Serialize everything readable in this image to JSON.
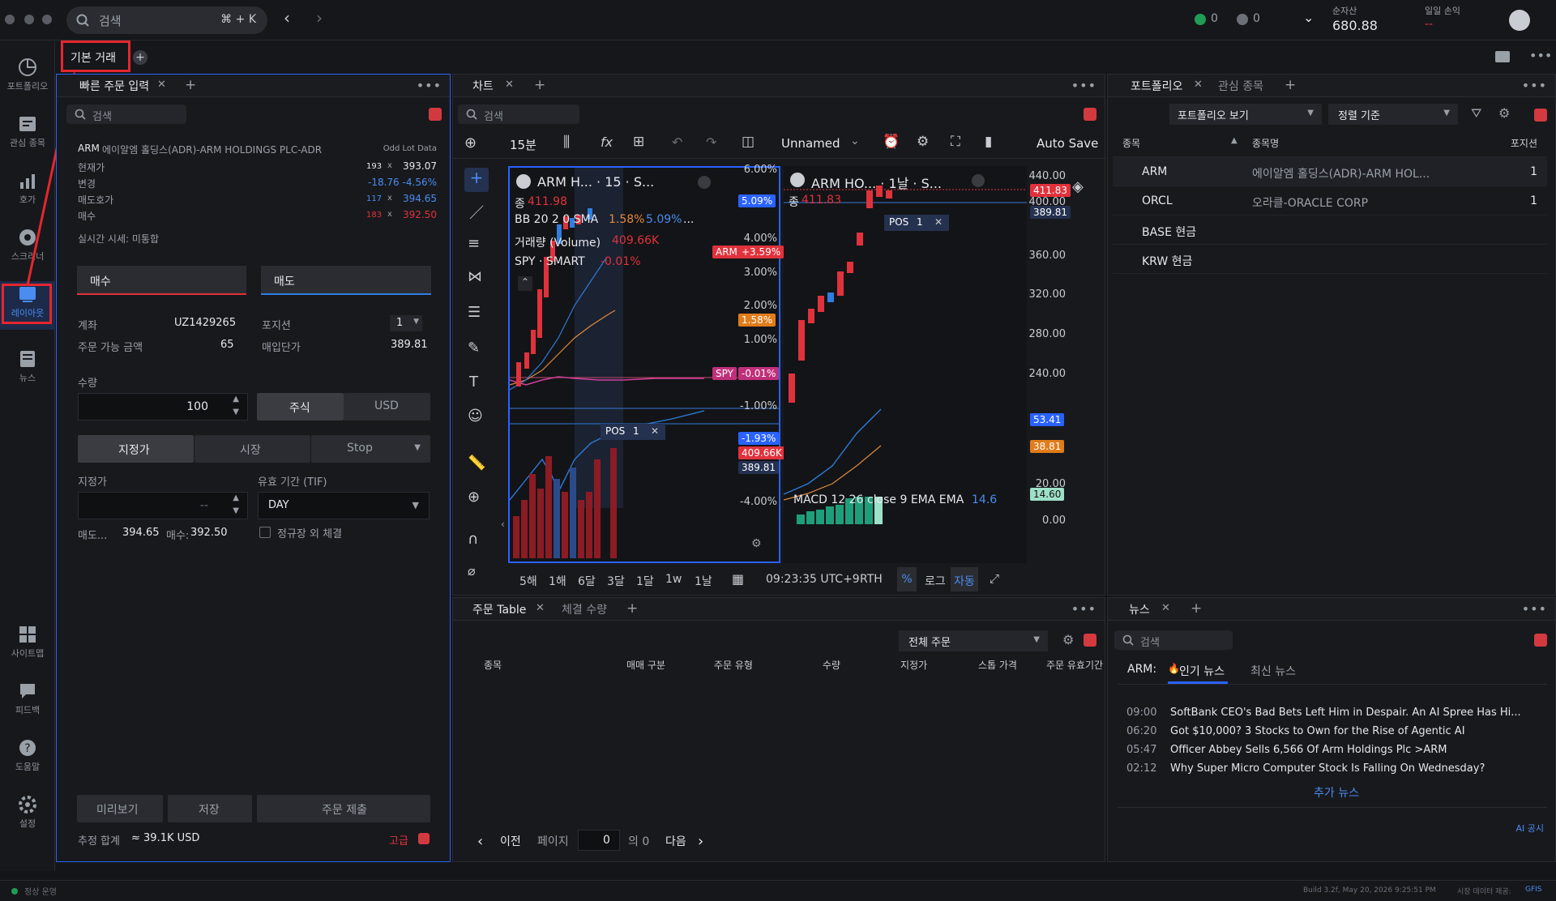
{
  "topbar": {
    "search_placeholder": "검색",
    "search_shortcut": "⌘ + K",
    "status_green_count": "0",
    "status_gray_count": "0",
    "net_assets_label": "순자산",
    "net_assets_value": "680.88",
    "daily_pl_label": "일일 손익",
    "daily_pl_value": "--"
  },
  "sidebar": {
    "items": [
      {
        "label": "포트폴리오",
        "icon": "portfolio-icon"
      },
      {
        "label": "관심 종목",
        "icon": "watchlist-icon"
      },
      {
        "label": "호가",
        "icon": "quote-icon"
      },
      {
        "label": "스크리너",
        "icon": "screener-icon"
      },
      {
        "label": "레이아웃",
        "icon": "layout-icon"
      },
      {
        "label": "뉴스",
        "icon": "news-icon"
      },
      {
        "label": "사이트맵",
        "icon": "sitemap-icon"
      },
      {
        "label": "피드백",
        "icon": "feedback-icon"
      },
      {
        "label": "도움말",
        "icon": "help-icon"
      },
      {
        "label": "설정",
        "icon": "settings-icon"
      }
    ]
  },
  "workspace_tab": "기본 거래",
  "order_panel": {
    "tab": "빠른 주문 입력",
    "search_placeholder": "검색",
    "symbol": "ARM",
    "symbol_name": "에이알엠 홀딩스(ADR)-ARM HOLDINGS PLC-ADR",
    "odd_lot": "Odd Lot Data",
    "rows": [
      {
        "label": "현재가",
        "qty": "193",
        "x": "x",
        "price": "393.07"
      },
      {
        "label": "변경",
        "qty": "-18.76",
        "x": "",
        "price": "-4.56%"
      },
      {
        "label": "매도호가",
        "qty": "117",
        "x": "x",
        "price": "394.65"
      },
      {
        "label": "매수",
        "qty": "183",
        "x": "x",
        "price": "392.50"
      }
    ],
    "realtime_note": "실시간 시세: 미통합",
    "buy_tab": "매수",
    "sell_tab": "매도",
    "account_label": "계좌",
    "account_value": "UZ1429265",
    "avail_label": "주문 가능 금액",
    "avail_value": "65",
    "position_label": "포지션",
    "position_value": "1",
    "avg_price_label": "매입단가",
    "avg_price_value": "389.81",
    "qty_label": "수량",
    "qty_value": "100",
    "unit_stock": "주식",
    "unit_usd": "USD",
    "type_limit": "지정가",
    "type_market": "시장",
    "type_stop": "Stop",
    "limit_label": "지정가",
    "limit_value": "--",
    "tif_label": "유효 기간 (TIF)",
    "tif_value": "DAY",
    "ask_label": "매도...",
    "ask_value": "394.65",
    "bid_label": "매수:",
    "bid_value": "392.50",
    "outside_rth": "정규장 외 체결",
    "preview_btn": "미리보기",
    "save_btn": "저장",
    "submit_btn": "주문 제출",
    "estimate_label": "추정 합계",
    "estimate_value": "≈ 39.1K USD",
    "advanced": "고급"
  },
  "chart_panel": {
    "tab": "차트",
    "search_placeholder": "검색",
    "interval": "15분",
    "layout_name": "Unnamed",
    "auto_save": "Auto Save",
    "left_chart": {
      "title": "ARM H... · 15 · S...",
      "close_label": "종",
      "close_value": "411.98",
      "bb": "BB 20 2 0 SMA",
      "bb_v1": "1.58%",
      "bb_v2": "5.09%",
      "bb_more": "...",
      "volume": "거래량 (Volume)",
      "volume_value": "409.66K",
      "spy": "SPY · SMART",
      "spy_value": "-0.01%",
      "y_labels": [
        "6.00%",
        "4.00%",
        "3.00%",
        "2.00%",
        "1.00%",
        "-1.00%",
        "-4.00%"
      ],
      "badges": {
        "b1": "5.09%",
        "arm": "ARM",
        "arm_val": "+3.59%",
        "b3": "1.58%",
        "spy": "SPY",
        "spy_val": "-0.01%",
        "neg": "-1.93%",
        "vol": "409.66K",
        "price": "389.81"
      },
      "pos": "POS",
      "pos_qty": "1"
    },
    "right_chart": {
      "title": "ARM HO... · 1날 · S...",
      "close_label": "종",
      "close_value": "411.83",
      "y_labels": [
        "440.00",
        "400.00",
        "360.00",
        "320.00",
        "280.00",
        "240.00",
        "20.00",
        "0.00"
      ],
      "badges": {
        "price1": "411.83",
        "price2": "389.81",
        "macd1": "53.41",
        "macd2": "38.81",
        "macd3": "14.60"
      },
      "macd": "MACD 12 26 close 9 EMA EMA",
      "macd_val": "14.6",
      "pos": "POS",
      "pos_qty": "1"
    },
    "ranges": [
      "5해",
      "1해",
      "6달",
      "3달",
      "1달",
      "1w",
      "1날"
    ],
    "time": "09:23:35 UTC+9",
    "rth": "RTH",
    "pct": "%",
    "log": "로그",
    "auto": "자동"
  },
  "orders_panel": {
    "tab1": "주문 Table",
    "tab2": "체결 수량",
    "filter": "전체 주문",
    "columns": [
      "종목",
      "매매 구분",
      "주문 유형",
      "수량",
      "지정가",
      "스톱 가격",
      "주문 유효기간"
    ],
    "prev": "이전",
    "page_label": "페이지",
    "page_value": "0",
    "of": "의 0",
    "next": "다음"
  },
  "portfolio_panel": {
    "tab1": "포트폴리오",
    "tab2": "관심 종목",
    "view": "포트폴리오 보기",
    "sort": "정렬 기준",
    "columns": [
      "종목",
      "종목명",
      "포지션"
    ],
    "rows": [
      {
        "symbol": "ARM",
        "name": "에이알엠 홀딩스(ADR)-ARM HOL...",
        "pos": "1"
      },
      {
        "symbol": "ORCL",
        "name": "오라클-ORACLE CORP",
        "pos": "1"
      },
      {
        "symbol": "BASE 현금",
        "name": "",
        "pos": ""
      },
      {
        "symbol": "KRW 현금",
        "name": "",
        "pos": ""
      }
    ]
  },
  "news_panel": {
    "tab": "뉴스",
    "search_placeholder": "검색",
    "symbol": "ARM:",
    "tab_hot": "인기 뉴스",
    "tab_latest": "최신 뉴스",
    "items": [
      {
        "time": "09:00",
        "headline": "SoftBank CEO's Bad Bets Left Him in Despair. An AI Spree Has Hi..."
      },
      {
        "time": "06:20",
        "headline": "Got $10,000? 3 Stocks to Own for the Rise of Agentic AI"
      },
      {
        "time": "05:47",
        "headline": "Officer Abbey Sells 6,566 Of Arm Holdings Plc >ARM"
      },
      {
        "time": "02:12",
        "headline": "Why Super Micro Computer Stock Is Falling On Wednesday?"
      }
    ],
    "more": "추가 뉴스",
    "ai": "AI 공시"
  },
  "statusbar": {
    "status": "정상 운영",
    "build": "Build 3.2f, May 20, 2026 9:25:51 PM",
    "data_label": "시장 데이터 제공:",
    "data_provider": "GFIS"
  },
  "colors": {
    "up": "#e0323c",
    "down": "#2f7de1",
    "accent": "#2962ff",
    "highlight": "#e3272e"
  }
}
